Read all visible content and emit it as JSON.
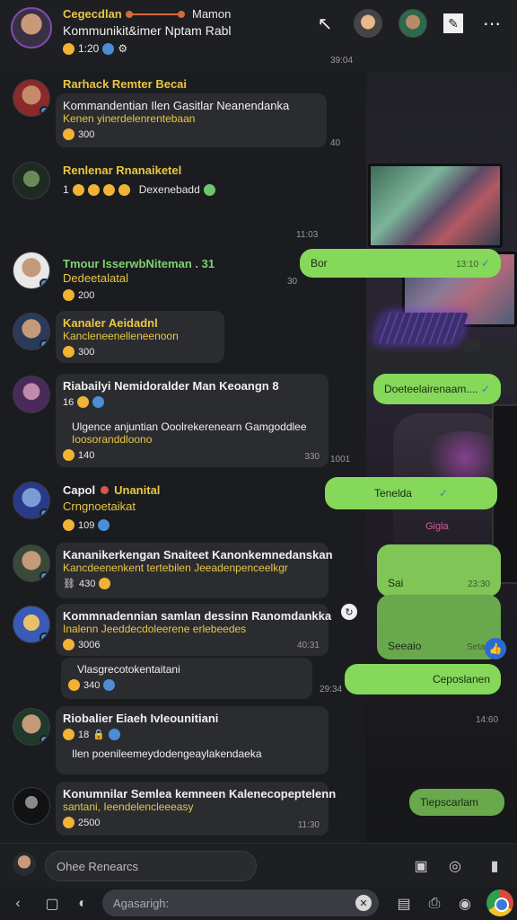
{
  "header": {
    "name_left": "Cegecdlan",
    "name_right": "Mamon",
    "subtitle": "Kommunikit&imer Nptam Rabl",
    "meta_count": "1:20",
    "time": "39:04"
  },
  "messages": [
    {
      "name": "Rarhack Remter Becai",
      "text": "Kommandentian Ilen Gasitlar Neanendanka",
      "text2": "Kenen yinerdelenrentebaan",
      "meta": "300",
      "time": "40"
    },
    {
      "name": "Renlenar Rnanaiketel",
      "text": "",
      "text2": "",
      "meta": "1",
      "tail": "Dexenebadd",
      "time": "11:03"
    },
    {
      "name": "Tmour IsserwbNiteman . 31",
      "text": "Dedeetalatal",
      "text2": "",
      "meta": "200",
      "time": "30"
    },
    {
      "name": "Kanaler Aeidadnl",
      "text": "Kancleneenelleneenoon",
      "text2": "",
      "meta": "300",
      "time": ""
    },
    {
      "name": "Riabailyi Nemidoralder Man Keoangn 8",
      "text": "Ulgence anjuntian Ooolrekerenearn Gamgoddlee",
      "text2": "Ioosoranddloono",
      "meta": "140",
      "time": "1001",
      "time_inner": "330"
    },
    {
      "name": "Capol",
      "name2": "Unanital",
      "text": "Crngnoetaikat",
      "text2": "",
      "meta": "109",
      "time": ""
    },
    {
      "name": "Kananikerkengan Snaiteet Kanonkemnedanskan",
      "text": "Kancdeenenkent tertebilen Jeeadenpenceelkgr",
      "text2": "",
      "meta": "430",
      "time": ""
    },
    {
      "name": "Kommnadennian samlan dessinn Ranomdankka",
      "text": "Inalenn Jeeddecdoleerene erlebeedes",
      "text2": "",
      "meta": "3006",
      "time": "40:31"
    },
    {
      "name": "",
      "text": "Vlasgrecotokentaitani",
      "text2": "",
      "meta": "340",
      "time": "29:34"
    },
    {
      "name": "Riobalier Eiaeh IvIeounitiani",
      "text": "",
      "text2": "Ilen poenileemeydodengeaylakendaeka",
      "meta": "18",
      "time": "14:60"
    },
    {
      "name": "Konumnilar Semlea kemneen Kalenecopeptelenn",
      "text": "santani, Ieendelencleeeasy",
      "text2": "",
      "meta": "2500",
      "time": "11:30"
    }
  ],
  "outgoing": [
    {
      "text": "Bor",
      "time": "13:10"
    },
    {
      "text": "Doeteelairenaam....",
      "time": ""
    },
    {
      "text": "Tenelda",
      "time": ""
    },
    {
      "text": "Sai",
      "time": "23:30"
    },
    {
      "text": "Seeaio",
      "time": "Setan"
    },
    {
      "text": "Ceposlanen",
      "time": ""
    },
    {
      "text": "Tiepscarlam",
      "time": ""
    }
  ],
  "scene_caption": "Gigla",
  "composer": {
    "placeholder": "Ohee Renearcs"
  },
  "navbar": {
    "search_placeholder": "Agasarigh:"
  }
}
